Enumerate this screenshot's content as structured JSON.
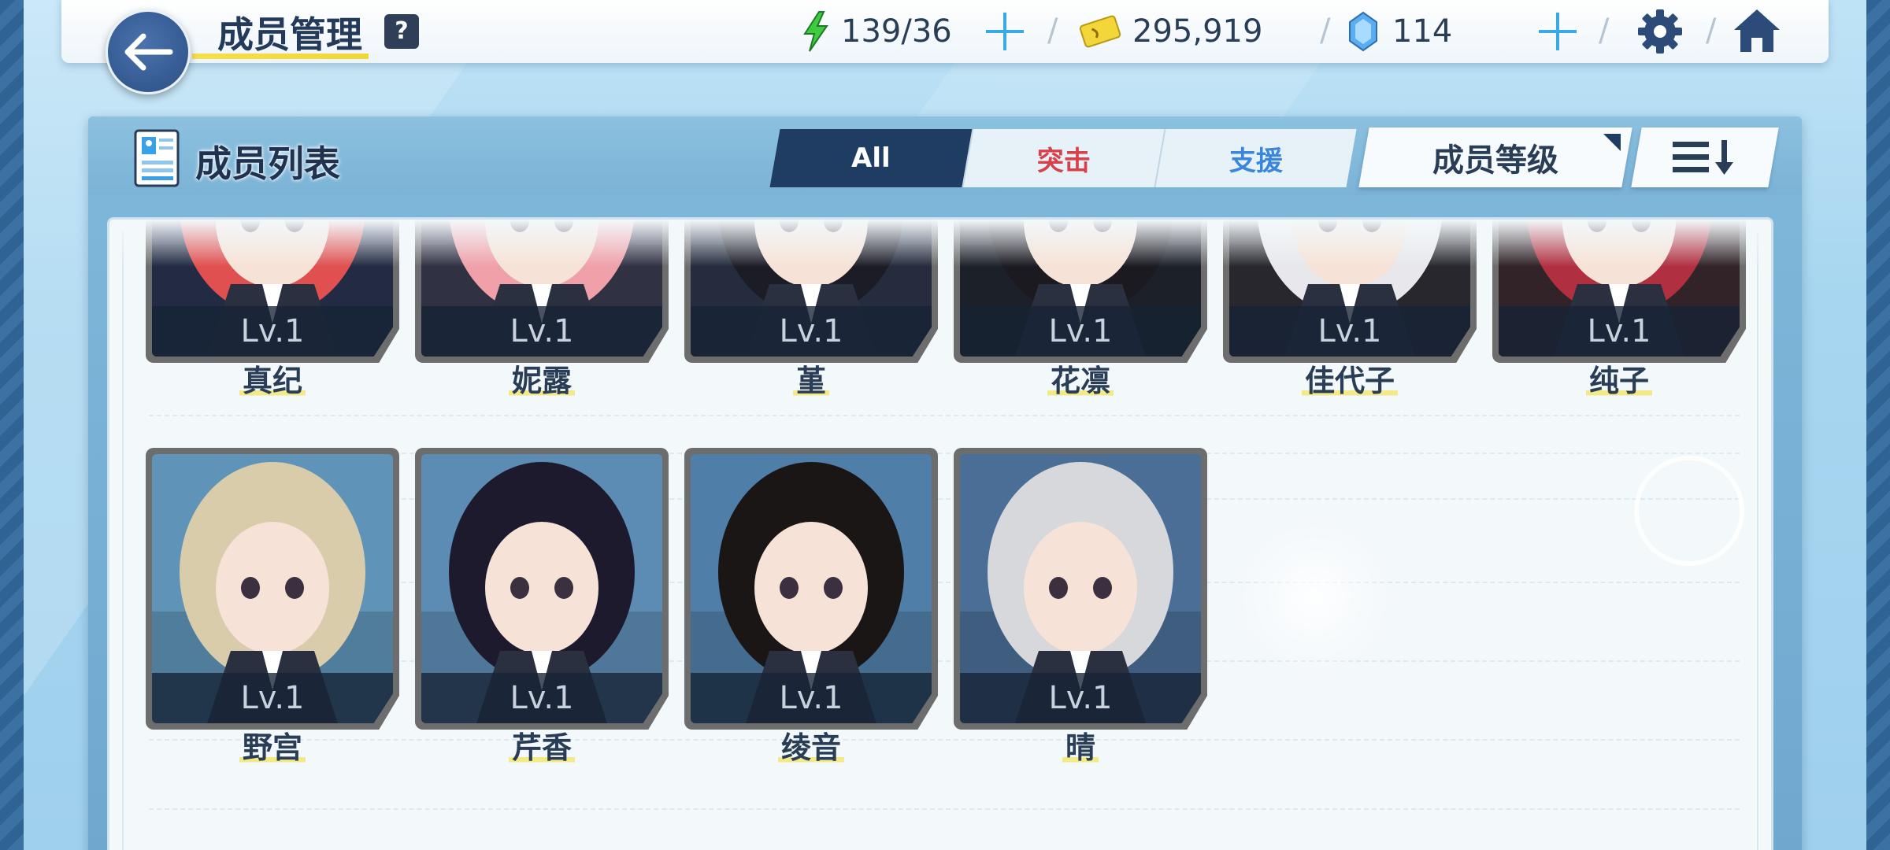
{
  "header": {
    "title": "成员管理",
    "help": "?",
    "ap": "139/36",
    "credits": "295,919",
    "gems": "114"
  },
  "panel": {
    "title": "成员列表",
    "tabs": [
      {
        "label": "All"
      },
      {
        "label": "突击"
      },
      {
        "label": "支援"
      }
    ],
    "sort_label": "成员等级"
  },
  "members": [
    {
      "name": "真纪",
      "level": "Lv.1",
      "bg": "#2a3350",
      "hair": "#e05050"
    },
    {
      "name": "妮露",
      "level": "Lv.1",
      "bg": "#3a3a50",
      "hair": "#f0a0a8"
    },
    {
      "name": "堇",
      "level": "Lv.1",
      "bg": "#2c3448",
      "hair": "#1c1c26"
    },
    {
      "name": "花凛",
      "level": "Lv.1",
      "bg": "#222630",
      "hair": "#1a1a20"
    },
    {
      "name": "佳代子",
      "level": "Lv.1",
      "bg": "#2e2e36",
      "hair": "#e8e8ec"
    },
    {
      "name": "纯子",
      "level": "Lv.1",
      "bg": "#3a2a30",
      "hair": "#b03040"
    },
    {
      "name": "野宫",
      "level": "Lv.1",
      "bg": "#5f93b8",
      "hair": "#d8ccaa"
    },
    {
      "name": "芹香",
      "level": "Lv.1",
      "bg": "#5c8cb4",
      "hair": "#1e1a2e"
    },
    {
      "name": "绫音",
      "level": "Lv.1",
      "bg": "#4f7fa8",
      "hair": "#1a1616"
    },
    {
      "name": "晴",
      "level": "Lv.1",
      "bg": "#4a6e96",
      "hair": "#d6d8dc"
    }
  ],
  "colors": {
    "accent_dark": "#1f3c63",
    "attack": "#d8414a",
    "support": "#3a86dd",
    "ap_icon": "#3ecb3e",
    "credit_icon": "#f3d63a",
    "gem_icon": "#5aaef0"
  }
}
